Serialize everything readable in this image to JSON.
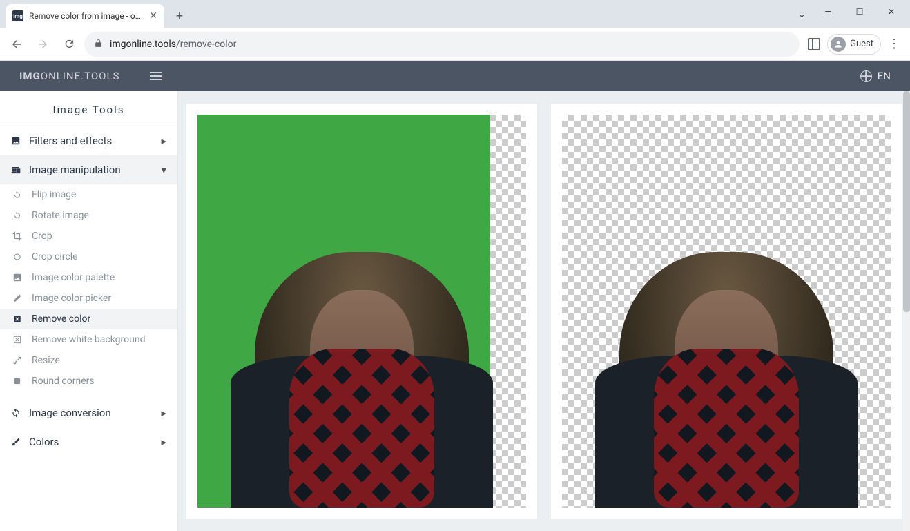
{
  "browser": {
    "tab_title": "Remove color from image - onlin",
    "url_host": "imgonline.tools",
    "url_path": "/remove-color",
    "guest_label": "Guest"
  },
  "header": {
    "brand_bold": "IMG",
    "brand_mid": "ONLINE",
    "brand_suffix": ".TOOLS",
    "lang": "EN"
  },
  "sidebar": {
    "title": "Image Tools",
    "cat_filters": "Filters and effects",
    "cat_manip": "Image manipulation",
    "cat_conv": "Image conversion",
    "cat_colors": "Colors",
    "sub": {
      "flip": "Flip image",
      "rotate": "Rotate image",
      "crop": "Crop",
      "crop_circle": "Crop circle",
      "palette": "Image color palette",
      "picker": "Image color picker",
      "remove_color": "Remove color",
      "remove_white": "Remove white background",
      "resize": "Resize",
      "round": "Round corners"
    }
  }
}
